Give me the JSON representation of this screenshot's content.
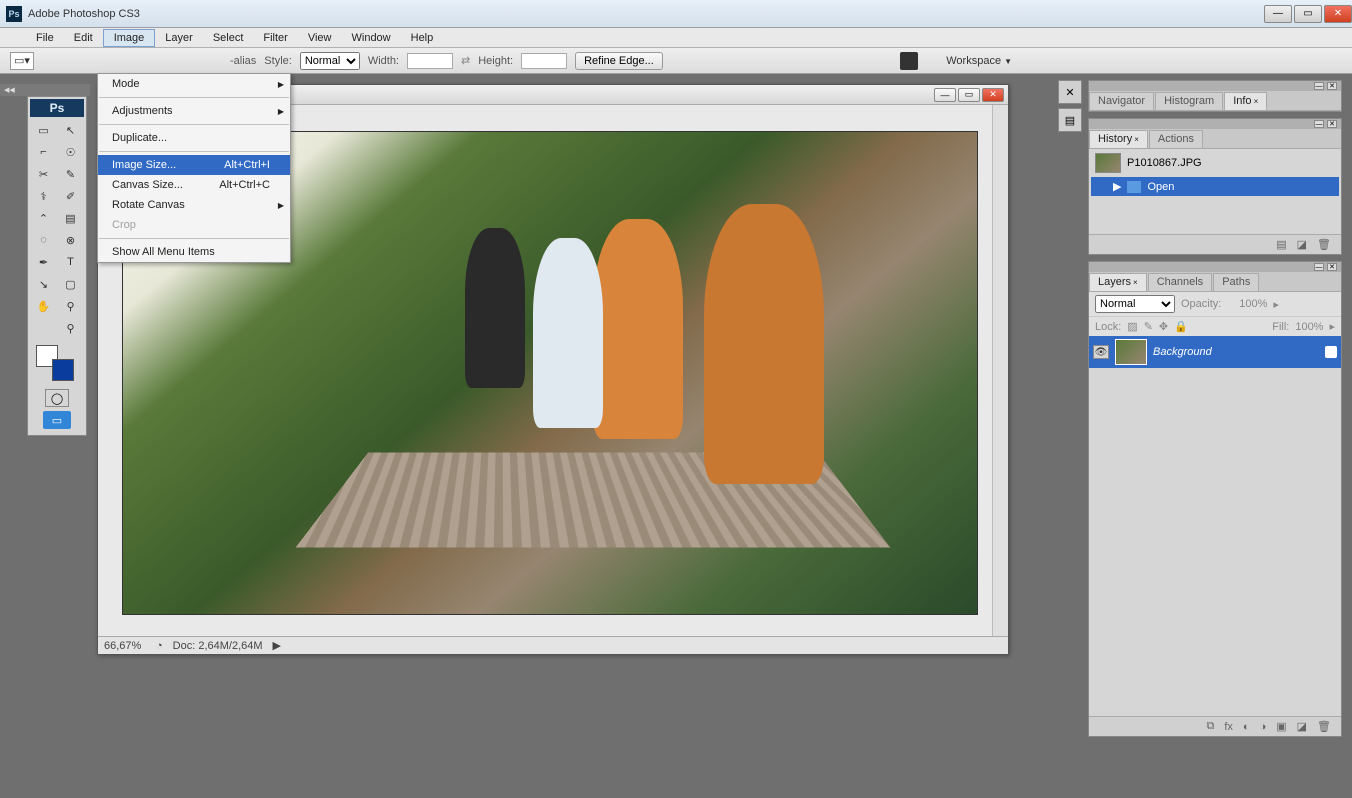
{
  "app": {
    "title": "Adobe Photoshop CS3",
    "icon_label": "Ps"
  },
  "menubar": {
    "items": [
      "File",
      "Edit",
      "Image",
      "Layer",
      "Select",
      "Filter",
      "View",
      "Window",
      "Help"
    ],
    "active_index": 2
  },
  "dropdown": {
    "items": [
      {
        "label": "Mode",
        "has_sub": true
      },
      {
        "type": "sep"
      },
      {
        "label": "Adjustments",
        "has_sub": true
      },
      {
        "type": "sep"
      },
      {
        "label": "Duplicate..."
      },
      {
        "type": "sep"
      },
      {
        "label": "Image Size...",
        "shortcut": "Alt+Ctrl+I",
        "highlighted": true
      },
      {
        "label": "Canvas Size...",
        "shortcut": "Alt+Ctrl+C"
      },
      {
        "label": "Rotate Canvas",
        "has_sub": true
      },
      {
        "label": "Crop",
        "disabled": true
      },
      {
        "type": "sep"
      },
      {
        "label": "Show All Menu Items"
      }
    ]
  },
  "optionsbar": {
    "alias_label": "-alias",
    "style_label": "Style:",
    "style_value": "Normal",
    "width_label": "Width:",
    "height_label": "Height:",
    "refine_label": "Refine Edge...",
    "workspace_label": "Workspace"
  },
  "tools": {
    "head": "Ps",
    "rows": [
      [
        "▭",
        "↖"
      ],
      [
        "⌐",
        "☉"
      ],
      [
        "✂",
        "✎"
      ],
      [
        "⚕",
        "✐"
      ],
      [
        "⌃",
        "▤"
      ],
      [
        "◌",
        "⊗"
      ],
      [
        "✒",
        "T"
      ],
      [
        "↘",
        "▢"
      ],
      [
        "✋",
        "⚲"
      ],
      [
        "",
        "⚲"
      ]
    ]
  },
  "document": {
    "zoom": "66,67%",
    "doc_info": "Doc: 2,64M/2,64M"
  },
  "panels": {
    "navigator_tabs": [
      "Navigator",
      "Histogram",
      "Info"
    ],
    "navigator_active": 2,
    "history_tabs": [
      "History",
      "Actions"
    ],
    "history_active": 0,
    "history_file": "P1010867.JPG",
    "history_step": "Open",
    "layers_tabs": [
      "Layers",
      "Channels",
      "Paths"
    ],
    "layers_active": 0,
    "layers_blend": "Normal",
    "opacity_label": "Opacity:",
    "opacity_value": "100%",
    "lock_label": "Lock:",
    "fill_label": "Fill:",
    "fill_value": "100%",
    "layer_name": "Background"
  }
}
